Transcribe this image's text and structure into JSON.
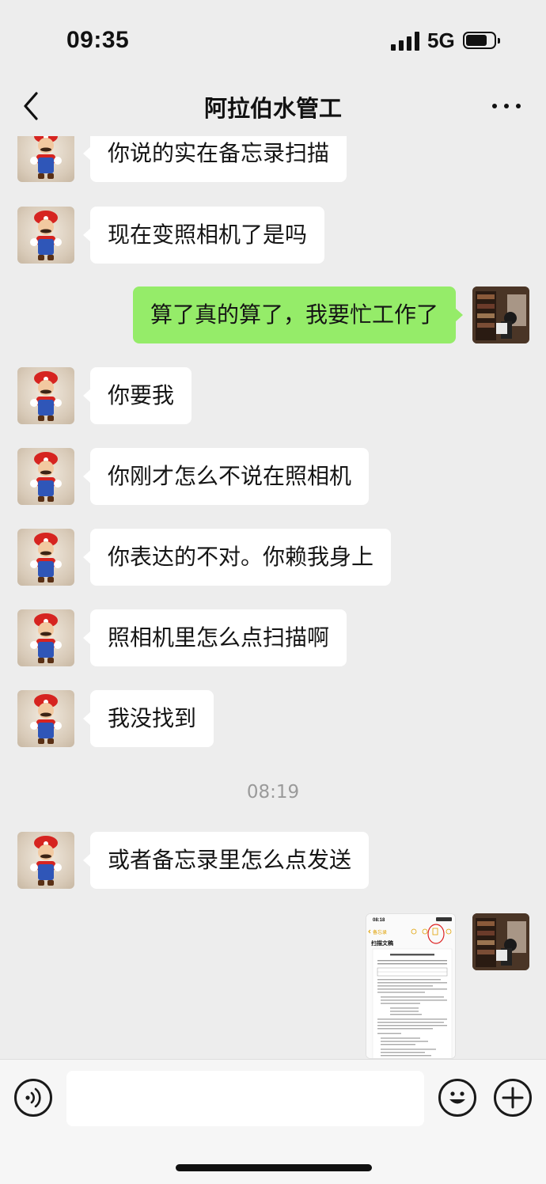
{
  "status_bar": {
    "time": "09:35",
    "network": "5G"
  },
  "nav": {
    "title": "阿拉伯水管工"
  },
  "messages": [
    {
      "side": "in",
      "text": "你说的实在备忘录扫描"
    },
    {
      "side": "in",
      "text": "现在变照相机了是吗"
    },
    {
      "side": "out",
      "text": "算了真的算了，我要忙工作了"
    },
    {
      "side": "in",
      "text": "你要我"
    },
    {
      "side": "in",
      "text": "你刚才怎么不说在照相机"
    },
    {
      "side": "in",
      "text": "你表达的不对。你赖我身上"
    },
    {
      "side": "in",
      "text": "照相机里怎么点扫描啊"
    },
    {
      "side": "in",
      "text": "我没找到"
    },
    {
      "side": "time",
      "text": "08:19"
    },
    {
      "side": "in",
      "text": "或者备忘录里怎么点发送"
    },
    {
      "side": "out",
      "type": "image"
    }
  ],
  "screenshot": {
    "back_label": "备忘录",
    "doc_title": "扫描文稿"
  },
  "input": {
    "placeholder": "",
    "value": ""
  },
  "icons": {
    "back": "chevron-left-icon",
    "more": "more-dots-icon",
    "voice": "voice-icon",
    "emoji": "emoji-icon",
    "plus": "plus-icon"
  },
  "colors": {
    "outgoing_bubble": "#95ec69",
    "incoming_bubble": "#ffffff",
    "background": "#ededed"
  }
}
